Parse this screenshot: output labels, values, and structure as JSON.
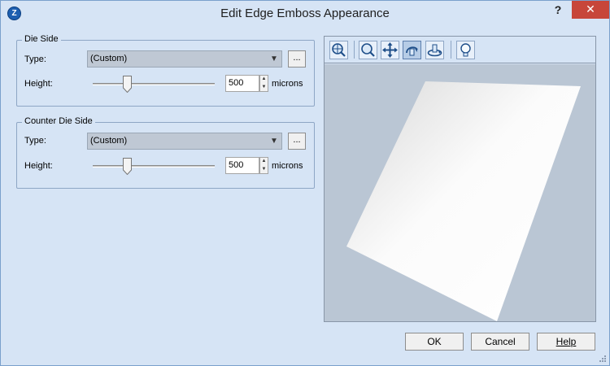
{
  "window": {
    "title": "Edit Edge Emboss Appearance",
    "help_glyph": "?",
    "close_glyph": "✕",
    "app_icon_letter": "Z"
  },
  "die_side": {
    "legend": "Die Side",
    "type_label": "Type:",
    "type_value": "(Custom)",
    "browse_label": "...",
    "height_label": "Height:",
    "height_value": "500",
    "unit": "microns",
    "slider_fraction": 0.28
  },
  "counter_die_side": {
    "legend": "Counter Die Side",
    "type_label": "Type:",
    "type_value": "(Custom)",
    "browse_label": "...",
    "height_label": "Height:",
    "height_value": "500",
    "unit": "microns",
    "slider_fraction": 0.28
  },
  "preview_toolbar": {
    "tools": [
      {
        "name": "zoom-extents-icon",
        "active": false
      },
      {
        "name": "zoom-icon",
        "active": false
      },
      {
        "name": "pan-icon",
        "active": false
      },
      {
        "name": "rotate-icon",
        "active": true
      },
      {
        "name": "spin-icon",
        "active": false
      },
      {
        "name": "light-bulb-icon",
        "active": false
      }
    ]
  },
  "buttons": {
    "ok": "OK",
    "cancel": "Cancel",
    "help": "Help"
  },
  "colors": {
    "accent": "#1d5fb0",
    "close": "#c7463a",
    "preview_bg": "#bac6d4"
  }
}
